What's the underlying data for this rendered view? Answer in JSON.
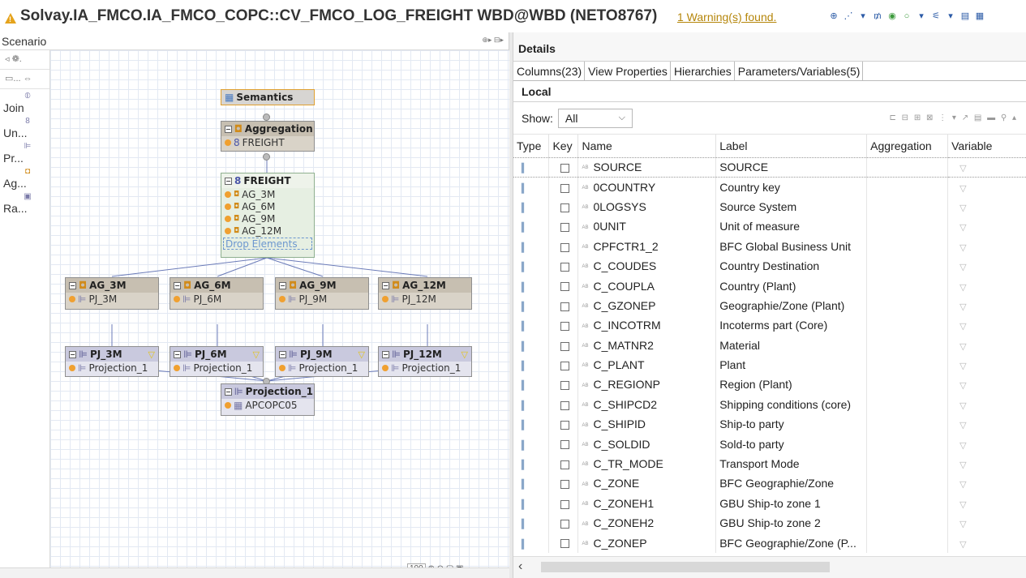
{
  "title": {
    "text": "Solvay.IA_FMCO.IA_FMCO_COPC::CV_FMCO_LOG_FREIGHT WBD@WBD (NETO8767)",
    "warning": "1 Warning(s) found."
  },
  "scenario": {
    "header": "Scenario",
    "palette": [
      {
        "icon": "join-icon",
        "label": "Join"
      },
      {
        "icon": "union-icon",
        "label": "Un..."
      },
      {
        "icon": "projection-icon",
        "label": "Pr..."
      },
      {
        "icon": "aggregation-icon",
        "label": "Ag..."
      },
      {
        "icon": "rank-icon",
        "label": "Ra..."
      }
    ],
    "zoom": "100",
    "nodes": {
      "semantics": "Semantics",
      "aggregation": {
        "title": "Aggregation",
        "items": [
          "FREIGHT"
        ]
      },
      "freight": {
        "title": "FREIGHT",
        "items": [
          "AG_3M",
          "AG_6M",
          "AG_9M",
          "AG_12M"
        ],
        "drop": "Drop Elements"
      },
      "aggs": [
        {
          "title": "AG_3M",
          "item": "PJ_3M"
        },
        {
          "title": "AG_6M",
          "item": "PJ_6M"
        },
        {
          "title": "AG_9M",
          "item": "PJ_9M"
        },
        {
          "title": "AG_12M",
          "item": "PJ_12M"
        }
      ],
      "projs": [
        {
          "title": "PJ_3M",
          "item": "Projection_1"
        },
        {
          "title": "PJ_6M",
          "item": "Projection_1"
        },
        {
          "title": "PJ_9M",
          "item": "Projection_1"
        },
        {
          "title": "PJ_12M",
          "item": "Projection_1"
        }
      ],
      "projection": {
        "title": "Projection_1",
        "item": "APCOPC05"
      }
    }
  },
  "details": {
    "header": "Details",
    "tabs": [
      "Columns(23)",
      "View Properties",
      "Hierarchies",
      "Parameters/Variables(5)"
    ],
    "local": "Local",
    "show_label": "Show:",
    "show_value": "All",
    "columns": [
      "Type",
      "Key",
      "Name",
      "Label",
      "Aggregation",
      "Variable"
    ],
    "rows": [
      {
        "name": "SOURCE",
        "label": "SOURCE"
      },
      {
        "name": "0COUNTRY",
        "label": "Country key"
      },
      {
        "name": "0LOGSYS",
        "label": "Source System"
      },
      {
        "name": "0UNIT",
        "label": "Unit of measure"
      },
      {
        "name": "CPFCTR1_2",
        "label": "BFC Global Business Unit"
      },
      {
        "name": "C_COUDES",
        "label": "Country Destination"
      },
      {
        "name": "C_COUPLA",
        "label": "Country (Plant)"
      },
      {
        "name": "C_GZONEP",
        "label": "Geographie/Zone (Plant)"
      },
      {
        "name": "C_INCOTRM",
        "label": "Incoterms part (Core)"
      },
      {
        "name": "C_MATNR2",
        "label": "Material"
      },
      {
        "name": "C_PLANT",
        "label": "Plant"
      },
      {
        "name": "C_REGIONP",
        "label": "Region (Plant)"
      },
      {
        "name": "C_SHIPCD2",
        "label": "Shipping conditions (core)"
      },
      {
        "name": "C_SHIPID",
        "label": "Ship-to party"
      },
      {
        "name": "C_SOLDID",
        "label": "Sold-to party"
      },
      {
        "name": "C_TR_MODE",
        "label": "Transport Mode"
      },
      {
        "name": "C_ZONE",
        "label": "BFC Geographie/Zone"
      },
      {
        "name": "C_ZONEH1",
        "label": "GBU Ship-to zone 1"
      },
      {
        "name": "C_ZONEH2",
        "label": "GBU Ship-to zone 2"
      },
      {
        "name": "C_ZONEP",
        "label": "BFC Geographie/Zone (P..."
      }
    ]
  }
}
